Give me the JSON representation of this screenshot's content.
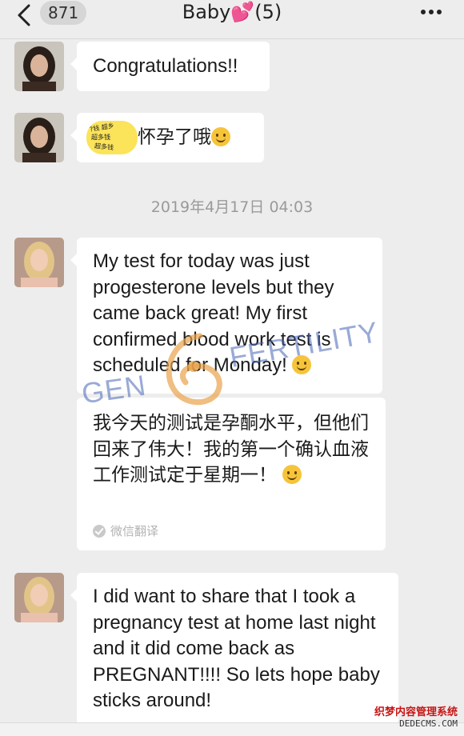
{
  "header": {
    "back_count": "871",
    "title_name": "Baby",
    "title_emoji": "💕",
    "title_count": "(5)"
  },
  "messages": {
    "m1": {
      "text": "Congratulations!!"
    },
    "m2": {
      "sticker_text": "超多钱",
      "text": "怀孕了哦"
    },
    "timestamp": "2019年4月17日 04:03",
    "m3": {
      "text": "My test for today was just progesterone levels but they came back great! My first confirmed blood work test is scheduled for Monday!",
      "translation": "我今天的测试是孕酮水平，但他们回来了伟大！我的第一个确认血液工作测试定于星期一！",
      "translation_note": "微信翻译"
    },
    "m4": {
      "text": "I did want to share that I took a pregnancy test at home last night and it did come back as PREGNANT!!!! So lets hope baby sticks around!"
    }
  },
  "watermark": {
    "left": "GEN",
    "right": "FERTILITY"
  },
  "site_mark": {
    "line1": "织梦内容管理系统",
    "line2": "DEDECMS.COM"
  },
  "colors": {
    "background": "#ededed",
    "bubble": "#ffffff",
    "timestamp": "#9a9a9a",
    "watermark_blue": "#4664b4",
    "watermark_orange": "#e8a24a"
  }
}
